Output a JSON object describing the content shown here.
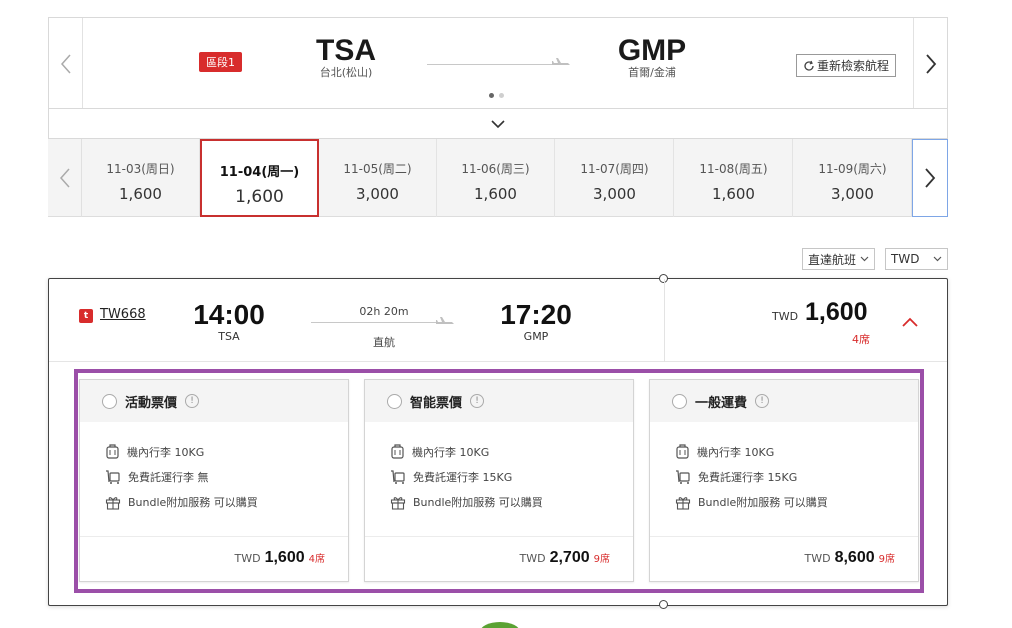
{
  "route": {
    "segment_label": "區段1",
    "origin": {
      "code": "TSA",
      "city": "台北(松山)"
    },
    "destination": {
      "code": "GMP",
      "city": "首爾/金浦"
    },
    "research_label": "重新檢索航程"
  },
  "dates": [
    {
      "date": "11-03(周日)",
      "price": "1,600"
    },
    {
      "date": "11-04(周一)",
      "price": "1,600",
      "selected": true
    },
    {
      "date": "11-05(周二)",
      "price": "3,000"
    },
    {
      "date": "11-06(周三)",
      "price": "1,600"
    },
    {
      "date": "11-07(周四)",
      "price": "3,000"
    },
    {
      "date": "11-08(周五)",
      "price": "1,600"
    },
    {
      "date": "11-09(周六)",
      "price": "3,000"
    }
  ],
  "filters": {
    "direct": "直達航班",
    "currency": "TWD"
  },
  "flight": {
    "airline_logo_glyph": "t",
    "number": "TW668",
    "departure": {
      "time": "14:00",
      "airport": "TSA"
    },
    "arrival": {
      "time": "17:20",
      "airport": "GMP"
    },
    "duration": "02h 20m",
    "stops": "直航",
    "price_currency": "TWD",
    "price": "1,600",
    "seats": "4席"
  },
  "fares": [
    {
      "name": "活動票價",
      "features": [
        "機內行李 10KG",
        "免費託運行李 無",
        "Bundle附加服務 可以購買"
      ],
      "currency": "TWD",
      "price": "1,600",
      "seats": "4席"
    },
    {
      "name": "智能票價",
      "features": [
        "機內行李 10KG",
        "免費託運行李 15KG",
        "Bundle附加服務 可以購買"
      ],
      "currency": "TWD",
      "price": "2,700",
      "seats": "9席"
    },
    {
      "name": "一般運費",
      "features": [
        "機內行李 10KG",
        "免費託運行李 15KG",
        "Bundle附加服務 可以購買"
      ],
      "currency": "TWD",
      "price": "8,600",
      "seats": "9席"
    }
  ],
  "colors": {
    "brand_red": "#d82c2c",
    "selected_border": "#c8302f",
    "highlight_purple": "#9b4fa8"
  },
  "icons": {
    "carry_on": "luggage-icon",
    "checked": "checked-baggage-icon",
    "bundle": "gift-icon",
    "info": "info-icon"
  }
}
